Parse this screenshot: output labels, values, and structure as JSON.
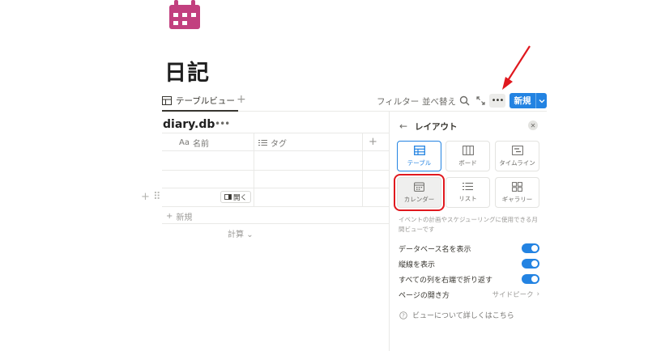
{
  "page": {
    "title": "日記",
    "icon": "calendar-icon"
  },
  "toolbar": {
    "view_tab": "テーブルビュー",
    "filter": "フィルター",
    "sort": "並べ替え",
    "new_label": "新規"
  },
  "database": {
    "name": "diary.db",
    "columns": [
      {
        "prefix": "Aa",
        "label": "名前"
      },
      {
        "icon": "list-icon",
        "label": "タグ"
      }
    ],
    "open_label": "開く",
    "new_row_label": "新規",
    "calc_label": "計算"
  },
  "layout_panel": {
    "title": "レイアウト",
    "options": [
      {
        "label": "テーブル",
        "icon": "table-icon",
        "selected": true
      },
      {
        "label": "ボード",
        "icon": "board-icon"
      },
      {
        "label": "タイムライン",
        "icon": "timeline-icon"
      },
      {
        "label": "カレンダー",
        "icon": "calendar-layout-icon",
        "highlighted": true
      },
      {
        "label": "リスト",
        "icon": "list-layout-icon"
      },
      {
        "label": "ギャラリー",
        "icon": "gallery-icon"
      }
    ],
    "description": "イベントの計画やスケジューリングに使用できる月間ビューです",
    "settings": [
      {
        "label": "データベース名を表示",
        "toggle": true
      },
      {
        "label": "縦線を表示",
        "toggle": true
      },
      {
        "label": "すべての列を右端で折り返す",
        "toggle": true
      },
      {
        "label": "ページの開き方",
        "value": "サイドピーク"
      }
    ],
    "help": "ビューについて詳しくはこちら"
  },
  "colors": {
    "accent": "#2383e2",
    "page_icon": "#c2407f",
    "annotation": "#e0181e"
  }
}
